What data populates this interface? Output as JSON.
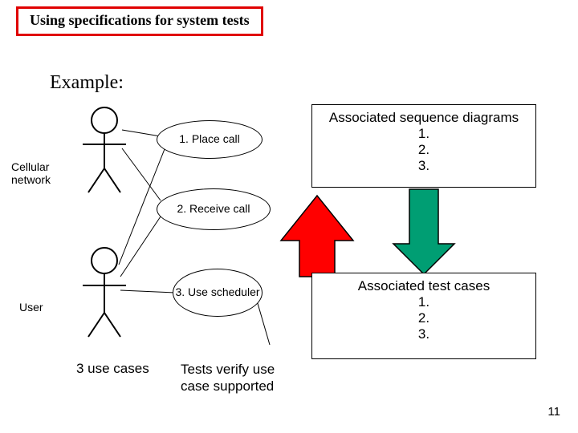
{
  "title": "Using specifications for system tests",
  "example_label": "Example:",
  "actors": {
    "cellular_network": "Cellular\nnetwork",
    "user": "User"
  },
  "usecases": {
    "uc1": "1. Place call",
    "uc2": "2. Receive call",
    "uc3": "3. Use scheduler"
  },
  "seq_box": {
    "header": "Associated sequence diagrams",
    "items": [
      "1.",
      "2.",
      "3."
    ]
  },
  "cases_box": {
    "header": "Associated test cases",
    "items": [
      "1.",
      "2.",
      "3."
    ]
  },
  "footer_note": "Tests verify use case supported",
  "cases_note": "3 use cases",
  "page_number": "11",
  "arrows": {
    "green_down": "arrow-sequence-to-cases",
    "red_up": "arrow-usecases-to-sequence"
  }
}
